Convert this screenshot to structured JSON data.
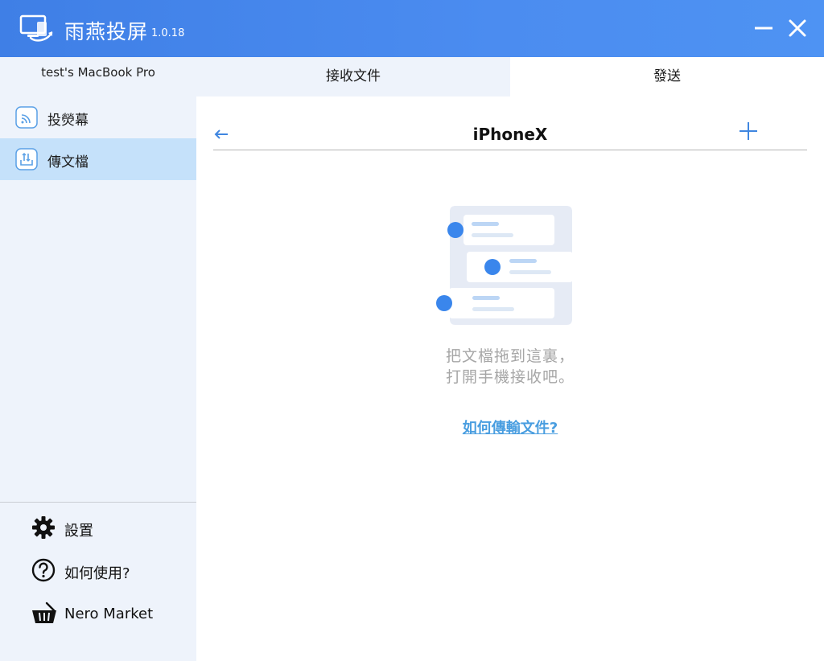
{
  "titlebar": {
    "app_name": "雨燕投屏",
    "version": "1.0.18",
    "minimize_icon": "minus-icon",
    "close_icon": "close-icon",
    "brand_color": "#4b8cf0"
  },
  "sidebar": {
    "device_name": "test's MacBook Pro",
    "nav_items": [
      {
        "label": "投熒幕",
        "icon": "cast-icon",
        "selected": false
      },
      {
        "label": "傳文檔",
        "icon": "file-transfer-icon",
        "selected": true
      }
    ],
    "bottom_items": [
      {
        "label": "設置",
        "icon": "gear-icon"
      },
      {
        "label": "如何使用?",
        "icon": "question-circle-icon"
      },
      {
        "label": "Nero Market",
        "icon": "basket-icon"
      }
    ],
    "selected_color": "#c5e1fa"
  },
  "tabs": [
    {
      "label": "接收文件",
      "active": false
    },
    {
      "label": "發送",
      "active": true
    }
  ],
  "main": {
    "device_title": "iPhoneX",
    "back_icon": "arrow-left-icon",
    "add_icon": "plus-icon",
    "hint_lines": [
      "把文檔拖到這裏，",
      "打開手機接收吧。"
    ],
    "help_link": "如何傳輸文件?",
    "link_color": "#4a9ee0"
  }
}
